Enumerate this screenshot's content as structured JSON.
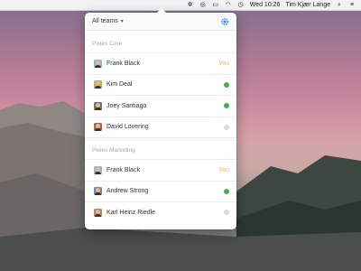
{
  "menubar": {
    "datetime": "Wed 10:26",
    "user": "Tim Kjær Lange",
    "icons": [
      "app-gear-icon",
      "fingerprint-icon",
      "airplay-icon",
      "wifi-icon",
      "time-machine-icon",
      "search-icon",
      "list-icon"
    ]
  },
  "popover": {
    "team_selector": "All teams",
    "sections": [
      {
        "title": "Pixies Core",
        "members": [
          {
            "name": "Frank Black",
            "status": "you",
            "label": "You"
          },
          {
            "name": "Kim Deal",
            "status": "online"
          },
          {
            "name": "Joey Santiago",
            "status": "online"
          },
          {
            "name": "David Lovering",
            "status": "offline"
          }
        ]
      },
      {
        "title": "Pixies Marketing",
        "members": [
          {
            "name": "Frank Black",
            "status": "you",
            "label": "You"
          },
          {
            "name": "Andrew Strong",
            "status": "online"
          },
          {
            "name": "Karl Heinz Riedle",
            "status": "offline"
          }
        ]
      }
    ]
  },
  "colors": {
    "accent": "#3a8ee6",
    "you": "#f0b429",
    "online": "#3cb44a",
    "offline": "#dcdcdc"
  }
}
